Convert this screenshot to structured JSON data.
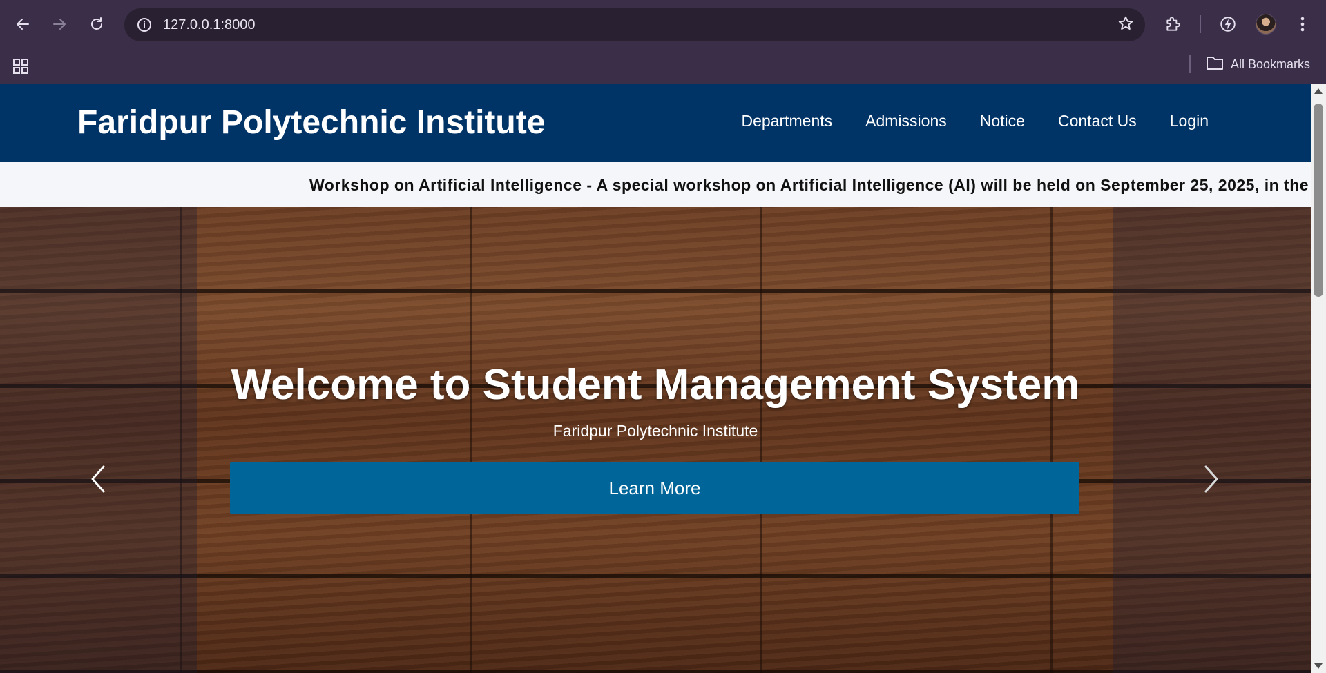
{
  "browser": {
    "url": "127.0.0.1:8000",
    "bookmarks_label": "All Bookmarks"
  },
  "site": {
    "title": "Faridpur Polytechnic Institute",
    "nav": [
      "Departments",
      "Admissions",
      "Notice",
      "Contact Us",
      "Login"
    ],
    "ticker": "Workshop on Artificial Intelligence - A special workshop on Artificial Intelligence (AI) will be held on September 25, 2025, in the"
  },
  "hero": {
    "title": "Welcome to Student Management System",
    "subtitle": "Faridpur Polytechnic Institute",
    "button_label": "Learn More"
  },
  "colors": {
    "header_bg": "#003366",
    "button_bg": "#006699",
    "chrome_bg": "#3a2e48"
  },
  "icons": {
    "back": "back-arrow-icon",
    "forward": "forward-arrow-icon",
    "reload": "reload-icon",
    "info": "info-icon",
    "star": "star-icon",
    "extensions": "puzzle-icon",
    "performance": "performance-icon",
    "menu": "kebab-menu-icon",
    "apps": "apps-grid-icon",
    "folder": "folder-icon",
    "prev": "chevron-left-icon",
    "next": "chevron-right-icon"
  }
}
